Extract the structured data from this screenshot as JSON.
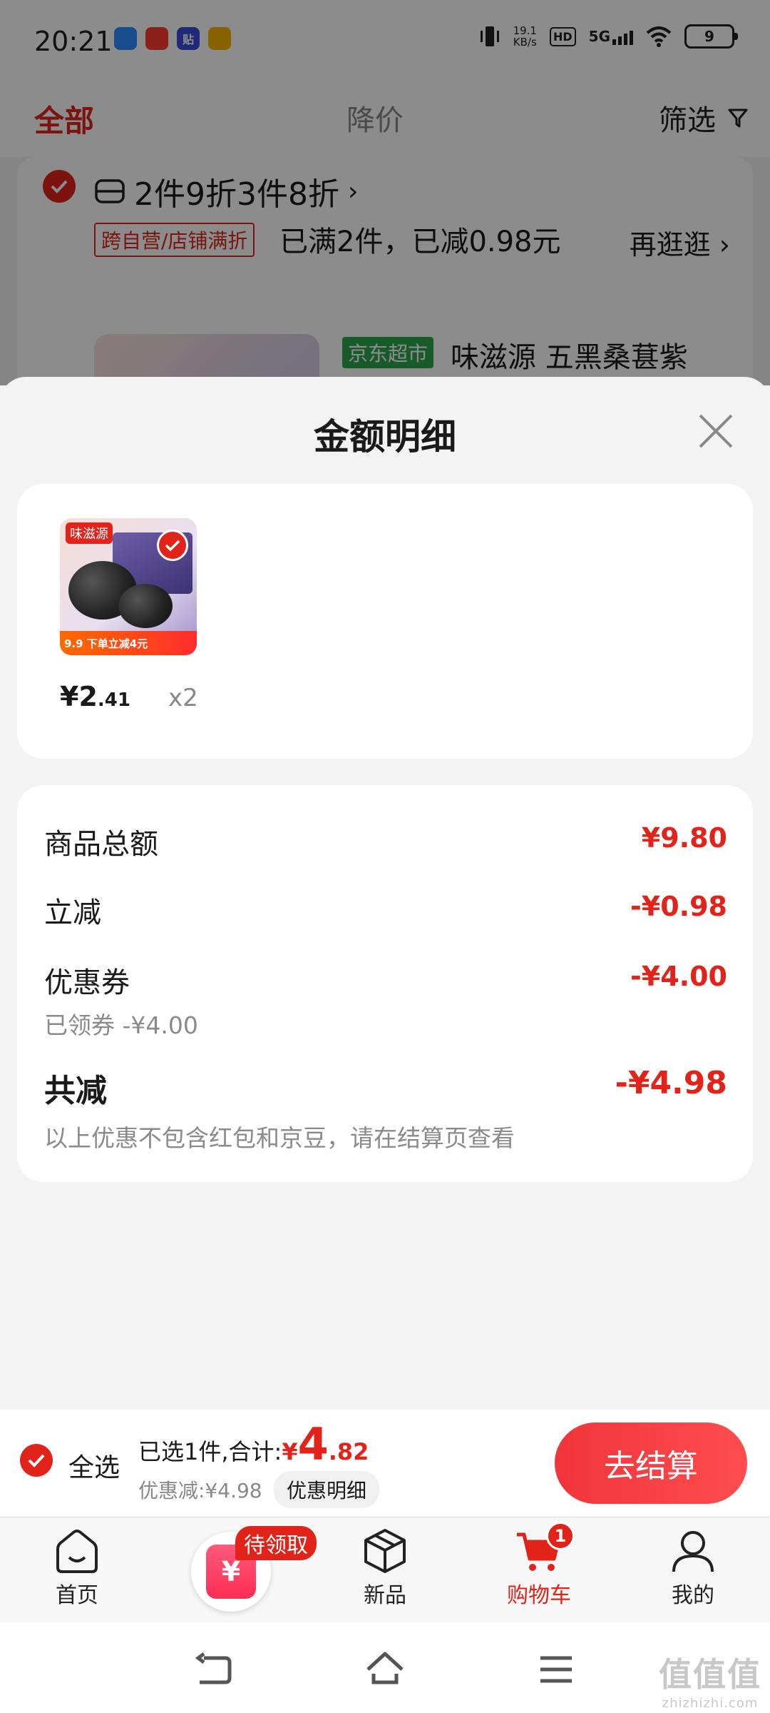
{
  "status": {
    "time": "20:21",
    "app_icons": [
      "browser-app-icon",
      "video-app-icon",
      "deal-app-icon",
      "pet-app-icon"
    ],
    "app_icon_texts": [
      "",
      "",
      "贴",
      ""
    ],
    "net_speed_value": "19.1",
    "net_speed_unit": "KB/s",
    "hd": "HD",
    "network": "5G",
    "battery": "9"
  },
  "cart": {
    "tab_all": "全部",
    "tab_price_drop": "降价",
    "filter": "筛选",
    "promo_title": "2件9折3件8折",
    "promo_tag": "跨自营/店铺满折",
    "promo_desc": "已满2件，已减0.98元",
    "browse_more": "再逛逛",
    "store_tag": "京东超市",
    "product_name": "味滋源 五黑桑葚紫"
  },
  "sheet": {
    "title": "金额明细",
    "item": {
      "brand_logo": "味滋源",
      "banner": "9.9 下单立减4元",
      "price_main": "¥2",
      "price_decimal": ".41",
      "quantity": "x2"
    },
    "rows": {
      "goods_total_label": "商品总额",
      "goods_total_value": "¥9.80",
      "instant_off_label": "立减",
      "instant_off_value": "-¥0.98",
      "coupon_label": "优惠券",
      "coupon_value": "-¥4.00",
      "coupon_sub": "已领券 -¥4.00",
      "total_off_label": "共减",
      "total_off_value": "-¥4.98",
      "note": "以上优惠不包含红包和京豆，请在结算页查看"
    }
  },
  "checkout": {
    "select_all": "全选",
    "selected_prefix": "已选1件,合计:",
    "yen": "¥",
    "amount_big": "4",
    "amount_small": ".82",
    "discount": "优惠减:¥4.98",
    "detail_button": "优惠明细",
    "checkout_button": "去结算"
  },
  "tabbar": {
    "home": "首页",
    "center_badge": "待领取",
    "center_icon_text": "¥",
    "new": "新品",
    "cart": "购物车",
    "cart_badge": "1",
    "mine": "我的"
  },
  "watermark": {
    "big": "值值值",
    "small": "zhizhizhi.com"
  },
  "colors": {
    "accent_red": "#e2231a",
    "jd_green": "#2ea44f"
  }
}
